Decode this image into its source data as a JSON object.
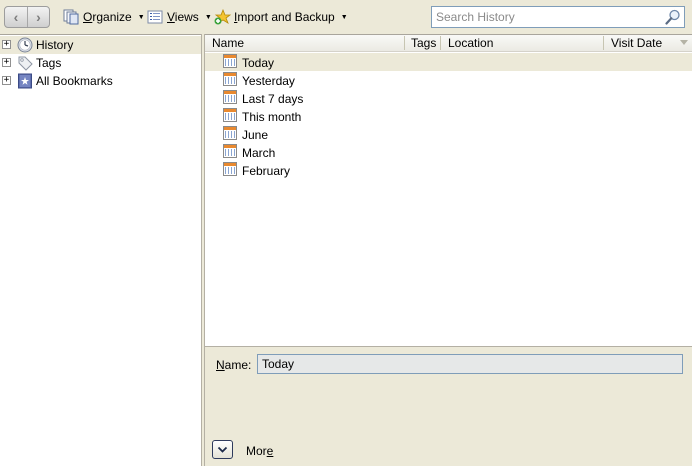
{
  "toolbar": {
    "back_glyph": "‹",
    "forward_glyph": "›",
    "organize": {
      "pre": "",
      "key": "O",
      "post": "rganize"
    },
    "views": {
      "pre": "",
      "key": "V",
      "post": "iews"
    },
    "import_backup": {
      "pre": "",
      "key": "I",
      "post": "mport and Backup"
    },
    "caret": "▼"
  },
  "search": {
    "placeholder": "Search History",
    "value": ""
  },
  "tree": {
    "items": [
      {
        "label": "History",
        "icon": "clock-icon",
        "expander": "+",
        "selected": true
      },
      {
        "label": "Tags",
        "icon": "tag-icon",
        "expander": "+",
        "selected": false
      },
      {
        "label": "All Bookmarks",
        "icon": "bookmarks-icon",
        "expander": "+",
        "selected": false
      }
    ]
  },
  "list": {
    "columns": {
      "name": "Name",
      "tags": "Tags",
      "location": "Location",
      "visit_date": "Visit Date"
    },
    "rows": [
      {
        "name": "Today",
        "selected": true
      },
      {
        "name": "Yesterday",
        "selected": false
      },
      {
        "name": "Last 7 days",
        "selected": false
      },
      {
        "name": "This month",
        "selected": false
      },
      {
        "name": "June",
        "selected": false
      },
      {
        "name": "March",
        "selected": false
      },
      {
        "name": "February",
        "selected": false
      }
    ]
  },
  "detail": {
    "name_label_key": "N",
    "name_label_rest": "ame:",
    "name_value": "Today",
    "more_label_pre": "Mor",
    "more_label_key": "e",
    "more_glyph": "⌄"
  },
  "colors": {
    "chrome": "#ece9d8",
    "selection": "#ece9d8",
    "field_border": "#7f9db9",
    "calendar_accent": "#e9892f"
  }
}
